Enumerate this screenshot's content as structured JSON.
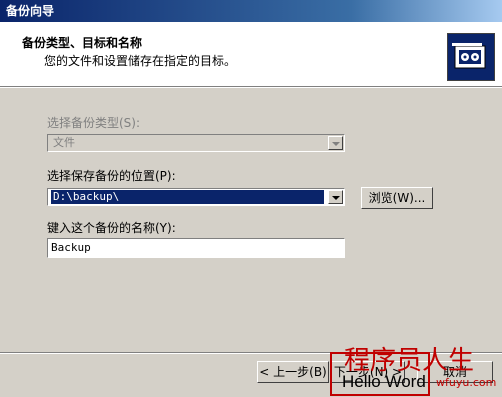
{
  "window": {
    "title": "备份向导"
  },
  "header": {
    "title": "备份类型、目标和名称",
    "subtitle": "您的文件和设置储存在指定的目标。",
    "logo_icon": "backup-media-icon"
  },
  "form": {
    "backup_type": {
      "label": "选择备份类型(S):",
      "value": "文件",
      "disabled": true
    },
    "location": {
      "label": "选择保存备份的位置(P):",
      "value": "D:\\backup\\",
      "browse_label": "浏览(W)..."
    },
    "name": {
      "label": "键入这个备份的名称(Y):",
      "value": "Backup"
    }
  },
  "buttons": {
    "back": "< 上一步(B)",
    "next": "下一步(N) >",
    "cancel": "取消"
  },
  "watermark": {
    "cn": "程序员人生",
    "en": "Hello Word",
    "url": "wfuyu.com"
  },
  "colors": {
    "title_bar": "#0a246a",
    "selection": "#0a246a",
    "watermark": "#c00000"
  }
}
